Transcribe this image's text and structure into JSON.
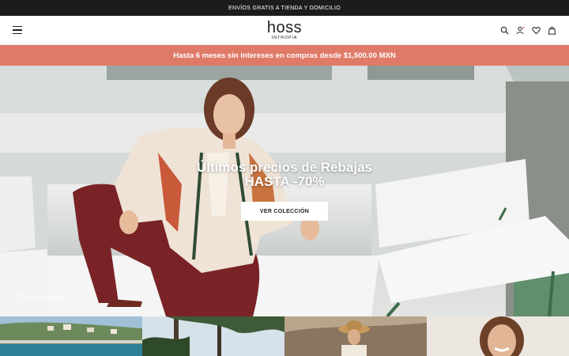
{
  "topbar": {
    "text": "ENVÍOS GRATIS A TIENDA Y DOMICILIO"
  },
  "header": {
    "logo_main": "hoss",
    "logo_sub": "INTROPIA",
    "icons": [
      "menu-icon",
      "search-icon",
      "user-icon",
      "heart-icon",
      "bag-icon"
    ]
  },
  "promo": {
    "text": "Hasta 6 meses sin intereses en compras desde $1,500.00 MXN"
  },
  "hero": {
    "title_line1": "Últimos precios de Rebajas",
    "title_line2": "HASTA -70%",
    "button_label": "VER COLECCIÓN",
    "conditions_label": "Ver condiciones"
  },
  "tiles": [
    "coastal-town-photo",
    "palm-trees-photo",
    "straw-hat-model-photo",
    "smiling-woman-photo"
  ],
  "colors": {
    "topbar": "#1c1c1c",
    "promo": "#e07a68",
    "button": "#ffffff"
  }
}
